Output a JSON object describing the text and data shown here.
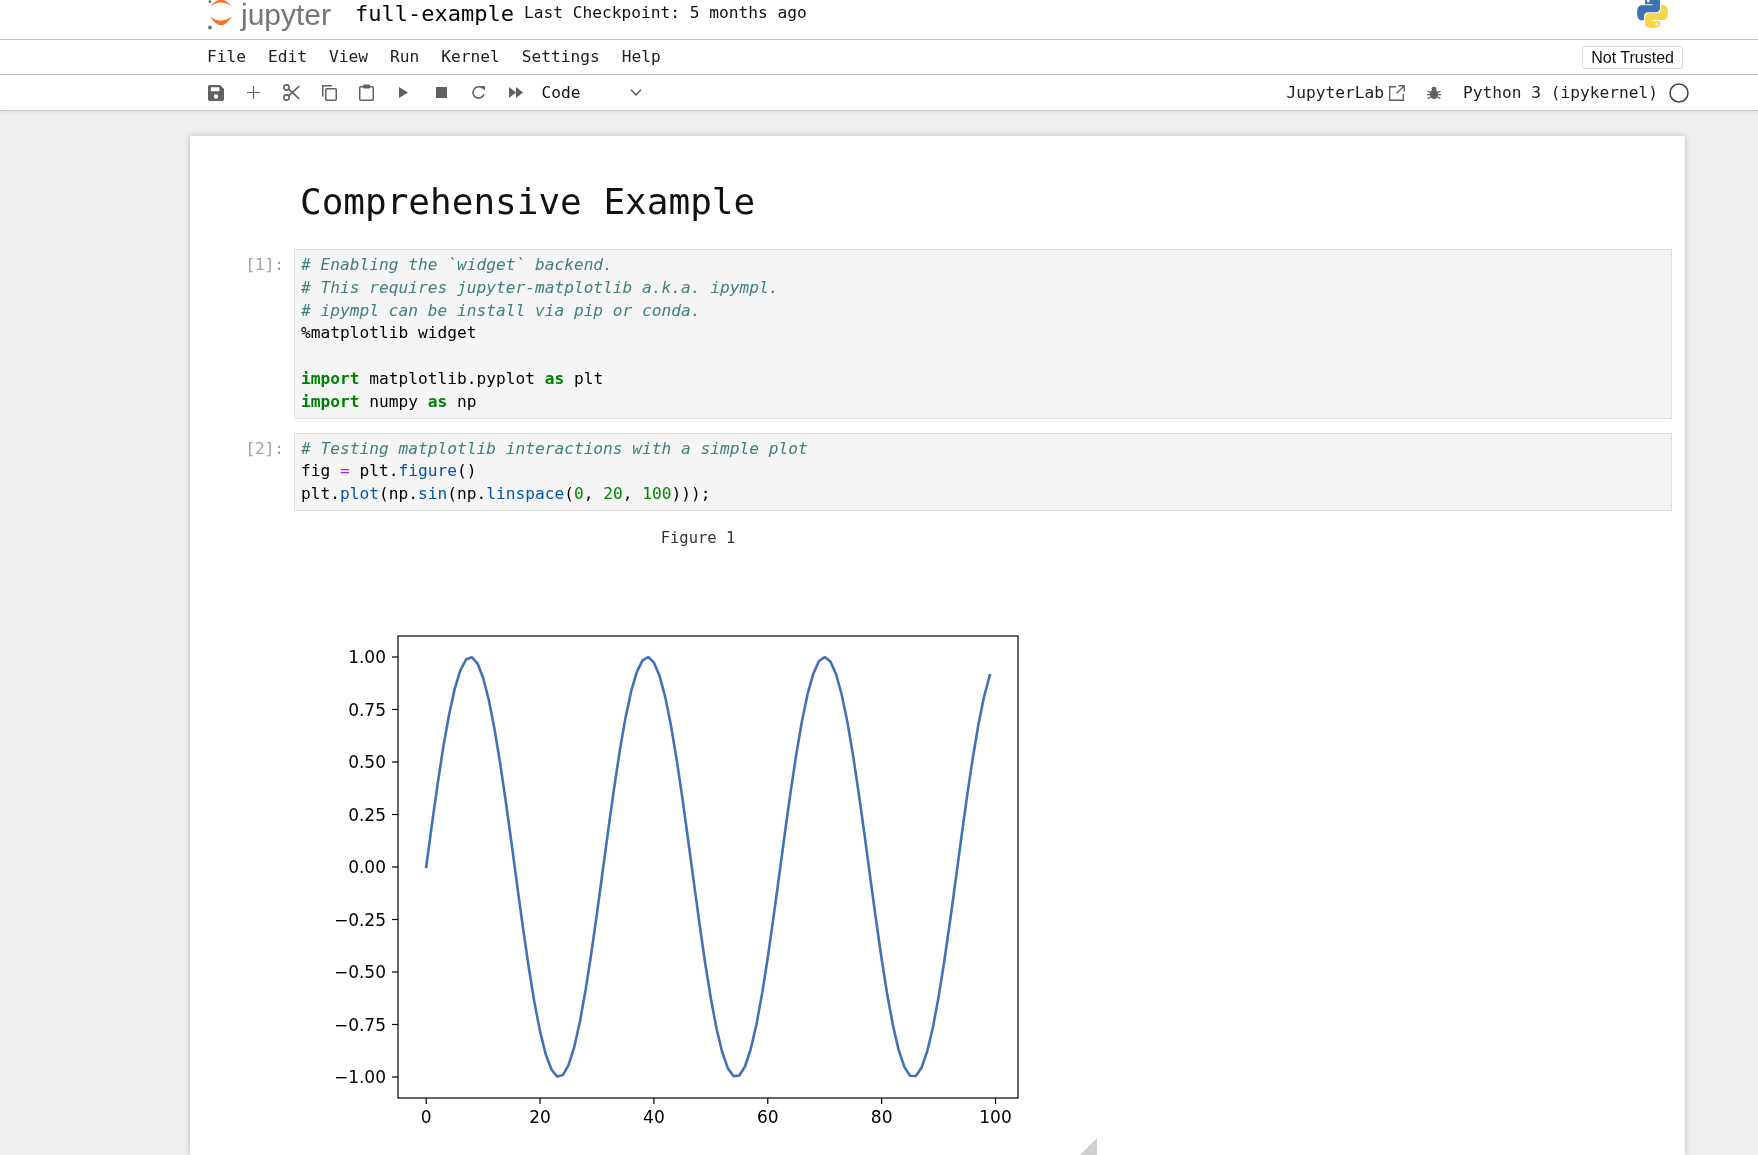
{
  "header": {
    "logo_text": "jupyter",
    "title": "full-example",
    "checkpoint": "Last Checkpoint: 5 months ago"
  },
  "menu": [
    "File",
    "Edit",
    "View",
    "Run",
    "Kernel",
    "Settings",
    "Help"
  ],
  "trust_status": "Not Trusted",
  "toolbar": {
    "buttons": [
      {
        "kind": "save"
      },
      {
        "kind": "insert"
      },
      {
        "kind": "cut"
      },
      {
        "kind": "copy"
      },
      {
        "kind": "paste"
      },
      {
        "kind": "run"
      },
      {
        "kind": "interrupt"
      },
      {
        "kind": "restart"
      },
      {
        "kind": "restart_run_all"
      }
    ],
    "cell_type": "Code",
    "open_in": "JupyterLab",
    "kernel": {
      "name": "Python 3 (ipykernel)",
      "busy": false
    }
  },
  "notebook": {
    "cells": [
      {
        "kind": "markdown",
        "heading": "Comprehensive Example"
      },
      {
        "kind": "code",
        "prompt": "[1]:",
        "blocks": [
          {
            "lines": [
              {
                "tokens": [
                  {
                    "kind": "comment",
                    "text": "# Enabling the `widget` backend."
                  }
                ]
              },
              {
                "tokens": [
                  {
                    "kind": "comment",
                    "text": "# This requires jupyter-matplotlib a.k.a. ipympl."
                  }
                ]
              },
              {
                "tokens": [
                  {
                    "kind": "comment",
                    "text": "# ipympl can be install via pip or conda."
                  }
                ]
              },
              {
                "tokens": [
                  {
                    "kind": "text",
                    "text": "%matplotlib widget"
                  }
                ]
              }
            ]
          },
          {
            "lines": [
              {
                "tokens": [
                  {
                    "kind": "keyword",
                    "text": "import"
                  },
                  {
                    "kind": "text",
                    "text": " matplotlib.pyplot "
                  },
                  {
                    "kind": "keyword",
                    "text": "as"
                  },
                  {
                    "kind": "text",
                    "text": " plt"
                  }
                ]
              },
              {
                "tokens": [
                  {
                    "kind": "keyword",
                    "text": "import"
                  },
                  {
                    "kind": "text",
                    "text": " numpy "
                  },
                  {
                    "kind": "keyword",
                    "text": "as"
                  },
                  {
                    "kind": "text",
                    "text": " np"
                  }
                ]
              }
            ]
          }
        ]
      },
      {
        "kind": "code",
        "prompt": "[2]:",
        "blocks": [
          {
            "lines": [
              {
                "tokens": [
                  {
                    "kind": "comment",
                    "text": "# Testing matplotlib interactions with a simple plot"
                  }
                ]
              },
              {
                "tokens": [
                  {
                    "kind": "text",
                    "text": "fig "
                  },
                  {
                    "kind": "operator",
                    "text": "="
                  },
                  {
                    "kind": "text",
                    "text": " plt."
                  },
                  {
                    "kind": "property",
                    "text": "figure"
                  },
                  {
                    "kind": "text",
                    "text": "()"
                  }
                ]
              },
              {
                "tokens": [
                  {
                    "kind": "text",
                    "text": "plt."
                  },
                  {
                    "kind": "property",
                    "text": "plot"
                  },
                  {
                    "kind": "text",
                    "text": "(np."
                  },
                  {
                    "kind": "property",
                    "text": "sin"
                  },
                  {
                    "kind": "text",
                    "text": "(np."
                  },
                  {
                    "kind": "property",
                    "text": "linspace"
                  },
                  {
                    "kind": "text",
                    "text": "("
                  },
                  {
                    "kind": "number",
                    "text": "0"
                  },
                  {
                    "kind": "text",
                    "text": ", "
                  },
                  {
                    "kind": "number",
                    "text": "20"
                  },
                  {
                    "kind": "text",
                    "text": ", "
                  },
                  {
                    "kind": "number",
                    "text": "100"
                  },
                  {
                    "kind": "text",
                    "text": ")));"
                  }
                ]
              }
            ]
          }
        ],
        "output": {
          "kind": "figure",
          "label": "Figure 1",
          "chart_data": {
            "type": "line",
            "x": [
              0,
              1,
              2,
              3,
              4,
              5,
              6,
              7,
              8,
              9,
              10,
              11,
              12,
              13,
              14,
              15,
              16,
              17,
              18,
              19,
              20,
              21,
              22,
              23,
              24,
              25,
              26,
              27,
              28,
              29,
              30,
              31,
              32,
              33,
              34,
              35,
              36,
              37,
              38,
              39,
              40,
              41,
              42,
              43,
              44,
              45,
              46,
              47,
              48,
              49,
              50,
              51,
              52,
              53,
              54,
              55,
              56,
              57,
              58,
              59,
              60,
              61,
              62,
              63,
              64,
              65,
              66,
              67,
              68,
              69,
              70,
              71,
              72,
              73,
              74,
              75,
              76,
              77,
              78,
              79,
              80,
              81,
              82,
              83,
              84,
              85,
              86,
              87,
              88,
              89,
              90,
              91,
              92,
              93,
              94,
              95,
              96,
              97,
              98,
              99
            ],
            "series": [
              {
                "color": "#4271b5",
                "values": [
                  0,
                  0.201,
                  0.393,
                  0.57,
                  0.723,
                  0.847,
                  0.936,
                  0.988,
                  0.999,
                  0.97,
                  0.901,
                  0.795,
                  0.657,
                  0.493,
                  0.308,
                  0.111,
                  -0.091,
                  -0.289,
                  -0.475,
                  -0.642,
                  -0.783,
                  -0.892,
                  -0.964,
                  -0.998,
                  -0.991,
                  -0.943,
                  -0.858,
                  -0.737,
                  -0.586,
                  -0.412,
                  -0.221,
                  -0.021,
                  0.18,
                  0.374,
                  0.553,
                  0.709,
                  0.836,
                  0.929,
                  0.984,
                  1.0,
                  0.974,
                  0.909,
                  0.808,
                  0.673,
                  0.511,
                  0.328,
                  0.131,
                  -0.07,
                  -0.269,
                  -0.457,
                  -0.626,
                  -0.77,
                  -0.882,
                  -0.959,
                  -0.996,
                  -0.993,
                  -0.95,
                  -0.868,
                  -0.751,
                  -0.603,
                  -0.431,
                  -0.241,
                  -0.041,
                  0.16,
                  0.355,
                  0.535,
                  0.694,
                  0.824,
                  0.921,
                  0.981,
                  1.0,
                  0.979,
                  0.918,
                  0.819,
                  0.688,
                  0.528,
                  0.347,
                  0.152,
                  -0.05,
                  -0.249,
                  -0.438,
                  -0.61,
                  -0.756,
                  -0.872,
                  -0.953,
                  -0.994,
                  -0.995,
                  -0.956,
                  -0.878,
                  -0.764,
                  -0.619,
                  -0.449,
                  -0.261,
                  -0.062,
                  0.14,
                  0.336,
                  0.518,
                  0.679,
                  0.812,
                  0.913
                ]
              }
            ],
            "xlim": [
              -4.95,
              103.95
            ],
            "ylim": [
              -1.1,
              1.1
            ],
            "xticks": [
              0,
              20,
              40,
              60,
              80,
              100
            ],
            "yticks": [
              {
                "value": -1,
                "label": "−1.00"
              },
              {
                "value": -0.75,
                "label": "−0.75"
              },
              {
                "value": -0.5,
                "label": "−0.50"
              },
              {
                "value": -0.25,
                "label": "−0.25"
              },
              {
                "value": 0,
                "label": "0.00"
              },
              {
                "value": 0.25,
                "label": "0.25"
              },
              {
                "value": 0.5,
                "label": "0.50"
              },
              {
                "value": 0.75,
                "label": "0.75"
              },
              {
                "value": 1,
                "label": "1.00"
              }
            ]
          }
        }
      }
    ]
  }
}
